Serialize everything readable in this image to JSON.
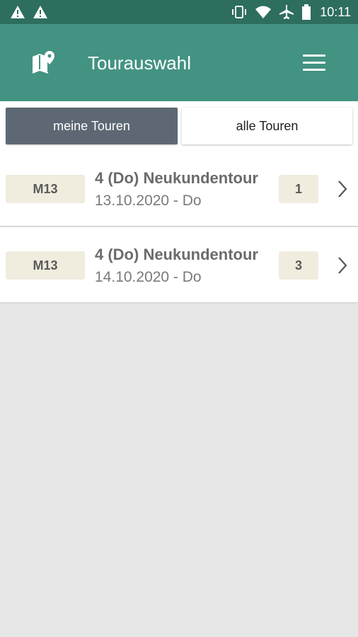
{
  "status_bar": {
    "time": "10:11",
    "left_icons": [
      "warning-icon",
      "warning-icon"
    ],
    "right_icons": [
      "vibrate-icon",
      "wifi-icon",
      "airplane-icon",
      "battery-icon"
    ]
  },
  "app_bar": {
    "icon": "map-pin-icon",
    "title": "Tourauswahl",
    "menu_icon": "hamburger-menu-icon",
    "background": "#439382"
  },
  "tabs": [
    {
      "label": "meine Touren",
      "active": true
    },
    {
      "label": "alle Touren",
      "active": false
    }
  ],
  "tours": [
    {
      "code": "M13",
      "title": "4 (Do) Neukundentour",
      "date": "13.10.2020 - Do",
      "count": "1"
    },
    {
      "code": "M13",
      "title": "4 (Do) Neukundentour",
      "date": "14.10.2020 - Do",
      "count": "3"
    }
  ],
  "colors": {
    "status_bar": "#2d6e5e",
    "active_tab": "#5d6874",
    "badge": "#f0ecde",
    "background": "#e6e6e6"
  }
}
